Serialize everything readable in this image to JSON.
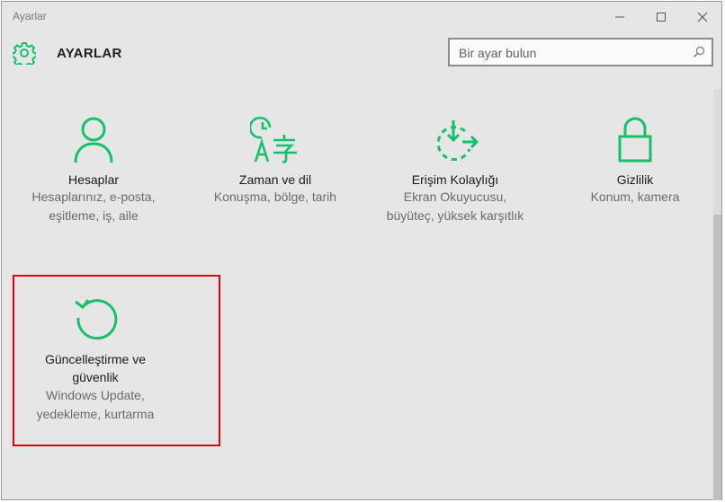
{
  "window": {
    "title": "Ayarlar"
  },
  "header": {
    "title": "AYARLAR"
  },
  "search": {
    "placeholder": "Bir ayar bulun"
  },
  "tiles": [
    {
      "id": "accounts",
      "name": "Hesaplar",
      "desc1": "Hesaplarınız, e-posta,",
      "desc2": "eşitleme, iş, aile",
      "icon": "person-icon"
    },
    {
      "id": "time-language",
      "name": "Zaman ve dil",
      "desc1": "Konuşma, bölge, tarih",
      "desc2": "",
      "icon": "time-language-icon"
    },
    {
      "id": "ease-of-access",
      "name": "Erişim Kolaylığı",
      "desc1": "Ekran Okuyucusu,",
      "desc2": "büyüteç, yüksek karşıtlık",
      "icon": "ease-of-access-icon"
    },
    {
      "id": "privacy",
      "name": "Gizlilik",
      "desc1": "Konum, kamera",
      "desc2": "",
      "icon": "lock-icon"
    },
    {
      "id": "update-security",
      "name1": "Güncelleştirme ve",
      "name2": "güvenlik",
      "desc1": "Windows Update,",
      "desc2": "yedekleme, kurtarma",
      "icon": "update-icon"
    }
  ],
  "colors": {
    "accent": "#13c26b",
    "highlight": "#e60012",
    "background": "#e6e6e6"
  }
}
